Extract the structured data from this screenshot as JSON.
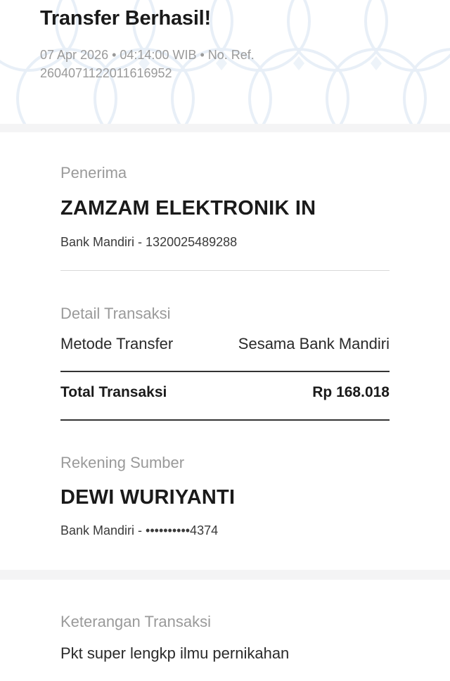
{
  "header": {
    "title": "Transfer Berhasil!",
    "meta_line1": "07 Apr 2026 • 04:14:00 WIB • No. Ref.",
    "meta_line2": "2604071122011616952"
  },
  "recipient": {
    "section_label": "Penerima",
    "name": "ZAMZAM ELEKTRONIK IN",
    "bank_account": "Bank Mandiri - 1320025489288"
  },
  "transaction_detail": {
    "section_label": "Detail Transaksi",
    "method_label": "Metode Transfer",
    "method_value": "Sesama Bank Mandiri",
    "total_label": "Total Transaksi",
    "total_value": "Rp 168.018"
  },
  "source_account": {
    "section_label": "Rekening Sumber",
    "name": "DEWI WURIYANTI",
    "bank_account": "Bank Mandiri - ••••••••••4374"
  },
  "note": {
    "section_label": "Keterangan Transaksi",
    "text": "Pkt super lengkp ilmu pernikahan"
  },
  "colors": {
    "pattern": "#e6eef6",
    "muted_text": "#9a9a9a",
    "band": "#f4f4f5"
  }
}
